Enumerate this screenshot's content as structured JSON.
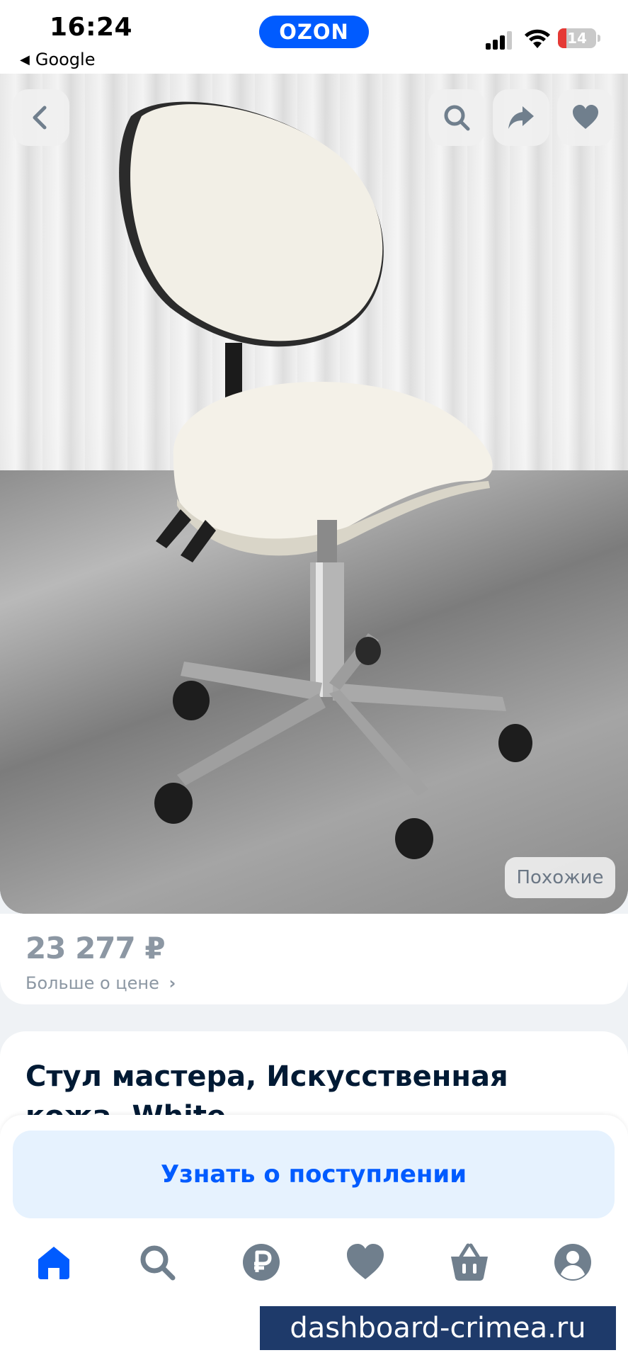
{
  "status_bar": {
    "time": "16:24",
    "back_app": "Google",
    "app_badge": "OZON",
    "battery": "14"
  },
  "product_photo": {
    "similar_label": "Похожие"
  },
  "price_block": {
    "price": "23 277 ₽",
    "more_label": "Больше о цене"
  },
  "product": {
    "title": "Стул мастера, Искусственная кожа, White"
  },
  "actions": {
    "notify_label": "Узнать о поступлении"
  },
  "tabbar": {
    "items": [
      "home-icon",
      "search-icon",
      "ruble-icon",
      "heart-icon",
      "basket-icon",
      "profile-icon"
    ],
    "active": "home-icon"
  },
  "watermark": "dashboard-crimea.ru",
  "colors": {
    "brand": "#005bff",
    "muted": "#8c97a3",
    "text": "#001a34"
  }
}
